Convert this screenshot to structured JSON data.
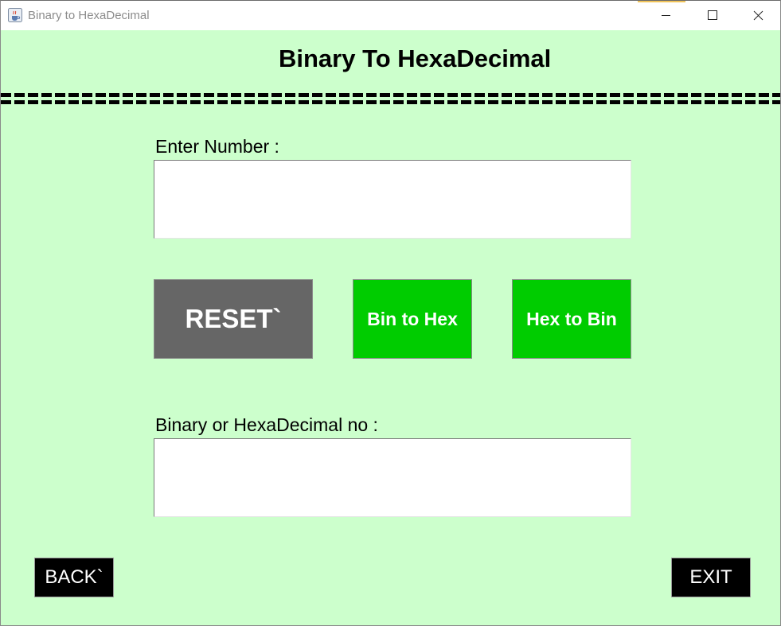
{
  "window": {
    "title": "Binary to HexaDecimal",
    "icon": "java-coffee-icon"
  },
  "header": {
    "title": "Binary To HexaDecimal"
  },
  "form": {
    "input_label": "Enter Number :",
    "input_value": "",
    "output_label": "Binary or HexaDecimal no :",
    "output_value": ""
  },
  "buttons": {
    "reset": "RESET`",
    "bin_to_hex": "Bin to Hex",
    "hex_to_bin": "Hex to Bin",
    "back": "BACK`",
    "exit": "EXIT"
  },
  "colors": {
    "background": "#ccffcc",
    "reset_button": "#666666",
    "convert_buttons": "#00cc00",
    "nav_buttons": "#000000"
  }
}
